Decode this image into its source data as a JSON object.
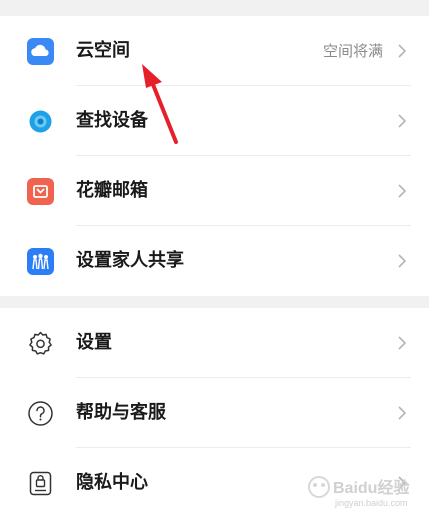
{
  "section1": {
    "items": [
      {
        "label": "云空间",
        "value": "空间将满",
        "icon": "cloud-icon",
        "icon_color": "#3a8af6"
      },
      {
        "label": "查找设备",
        "value": "",
        "icon": "find-device-icon",
        "icon_color": "#1fa1e8"
      },
      {
        "label": "花瓣邮箱",
        "value": "",
        "icon": "mail-icon",
        "icon_color": "#f0634f"
      },
      {
        "label": "设置家人共享",
        "value": "",
        "icon": "family-share-icon",
        "icon_color": "#2c7ef5"
      }
    ]
  },
  "section2": {
    "items": [
      {
        "label": "设置",
        "icon": "gear-icon"
      },
      {
        "label": "帮助与客服",
        "icon": "help-icon"
      },
      {
        "label": "隐私中心",
        "icon": "privacy-icon"
      }
    ]
  },
  "annotation": {
    "arrow_color": "#e5202a"
  },
  "watermark": {
    "text": "Baidu经验",
    "url": "jingyan.baidu.com"
  }
}
